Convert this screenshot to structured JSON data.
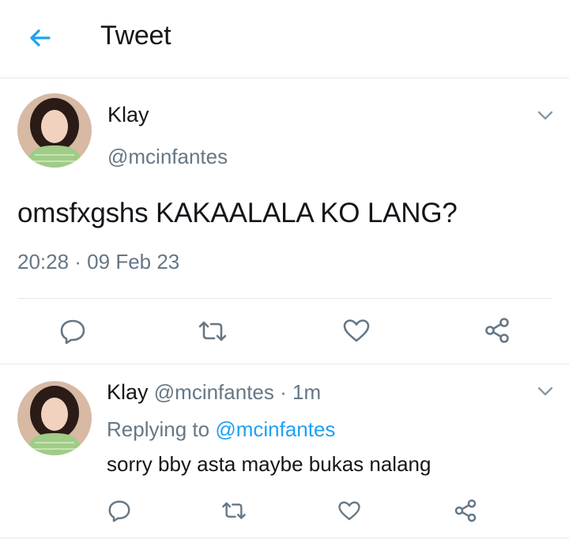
{
  "header": {
    "title": "Tweet"
  },
  "main_tweet": {
    "name": "Klay",
    "handle": "@mcinfantes",
    "text": "omsfxgshs KAKAALALA KO LANG?",
    "timestamp": "20:28 · 09 Feb 23"
  },
  "reply": {
    "name": "Klay",
    "handle": "@mcinfantes",
    "age": "· 1m",
    "replying_label": "Replying to",
    "replying_to": "@mcinfantes",
    "text": "sorry bby asta maybe bukas nalang"
  },
  "colors": {
    "accent": "#1da1f2",
    "muted": "#657786",
    "divider": "#e1e8ed"
  },
  "icons": [
    "back-arrow-icon",
    "chevron-down-icon",
    "reply-icon",
    "retweet-icon",
    "like-icon",
    "share-icon"
  ]
}
